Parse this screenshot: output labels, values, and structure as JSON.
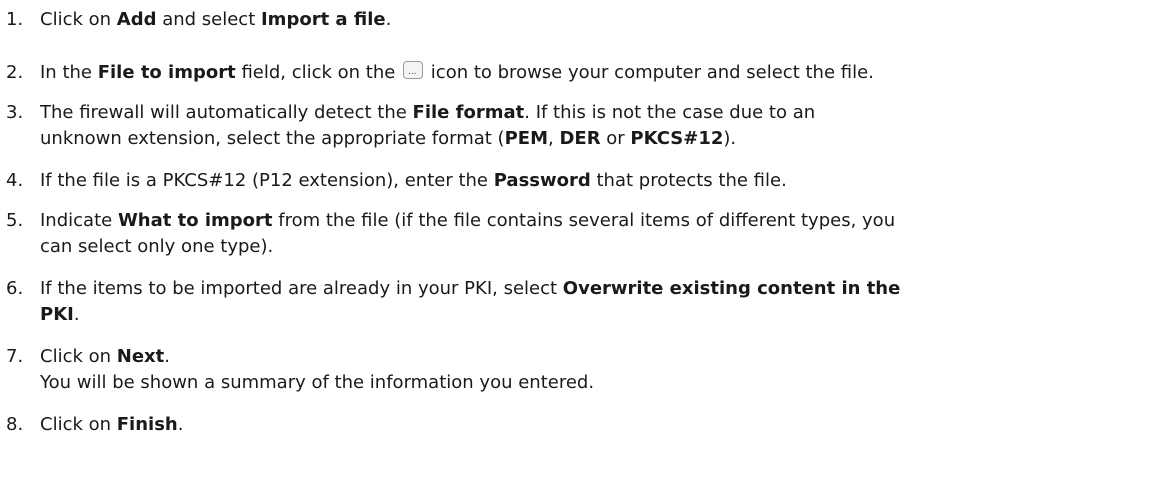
{
  "steps": [
    {
      "number": "1.",
      "lines": [
        [
          {
            "t": "Click on "
          },
          {
            "t": "Add",
            "b": true
          },
          {
            "t": " and select "
          },
          {
            "t": "Import a file",
            "b": true
          },
          {
            "t": "."
          }
        ]
      ]
    },
    {
      "number": "2.",
      "lines": [
        [
          {
            "t": "In the "
          },
          {
            "t": "File to import",
            "b": true
          },
          {
            "t": " field, click on the "
          },
          {
            "icon": "browse-icon"
          },
          {
            "t": " icon to browse your computer and select the file."
          }
        ]
      ]
    },
    {
      "number": "3.",
      "lines": [
        [
          {
            "t": "The firewall will automatically detect the "
          },
          {
            "t": "File format",
            "b": true
          },
          {
            "t": ". If this is not the case due to an"
          }
        ],
        [
          {
            "t": "unknown extension, select the appropriate format ("
          },
          {
            "t": "PEM",
            "b": true
          },
          {
            "t": ", "
          },
          {
            "t": "DER",
            "b": true
          },
          {
            "t": " or "
          },
          {
            "t": "PKCS#12",
            "b": true
          },
          {
            "t": ")."
          }
        ]
      ]
    },
    {
      "number": "4.",
      "lines": [
        [
          {
            "t": "If the file is a PKCS#12 (P12 extension), enter the "
          },
          {
            "t": "Password",
            "b": true
          },
          {
            "t": " that protects the file."
          }
        ]
      ]
    },
    {
      "number": "5.",
      "lines": [
        [
          {
            "t": "Indicate "
          },
          {
            "t": "What to import",
            "b": true
          },
          {
            "t": " from the file (if the file contains several items of different types, you"
          }
        ],
        [
          {
            "t": "can select only one type)."
          }
        ]
      ]
    },
    {
      "number": "6.",
      "lines": [
        [
          {
            "t": "If the items to be imported are already in your PKI, select "
          },
          {
            "t": "Overwrite existing content in the",
            "b": true
          }
        ],
        [
          {
            "t": "PKI",
            "b": true
          },
          {
            "t": "."
          }
        ]
      ]
    },
    {
      "number": "7.",
      "lines": [
        [
          {
            "t": "Click on "
          },
          {
            "t": "Next",
            "b": true
          },
          {
            "t": "."
          }
        ],
        [
          {
            "t": "You will be shown a summary of the information you entered."
          }
        ]
      ]
    },
    {
      "number": "8.",
      "lines": [
        [
          {
            "t": "Click on "
          },
          {
            "t": "Finish",
            "b": true
          },
          {
            "t": "."
          }
        ]
      ]
    }
  ]
}
